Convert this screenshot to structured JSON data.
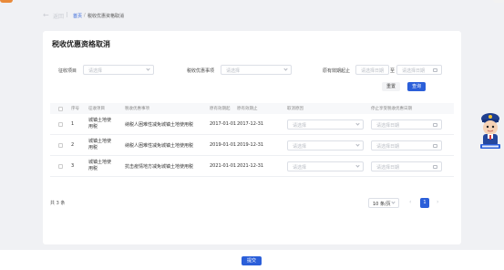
{
  "nav": {
    "back": "返回",
    "home": "首页",
    "sep": "/",
    "current": "税收优惠资格取消",
    "back_icon": "arrow-left-icon"
  },
  "page": {
    "title": "税收优惠资格取消"
  },
  "filters": {
    "levy_item_label": "征收项目",
    "levy_item_placeholder": "请选择",
    "pref_item_label": "税收优惠事项",
    "pref_item_placeholder": "请选择",
    "valid_range_label": "原有效期起止",
    "start_placeholder": "请选择日期",
    "range_sep": "至",
    "end_placeholder": "请选择日期"
  },
  "buttons": {
    "reset": "重置",
    "query": "查询",
    "submit": "提交"
  },
  "table": {
    "headers": [
      "序号",
      "征收项目",
      "税收优惠事项",
      "原有效期起",
      "原有效期止",
      "取消原因",
      "停止享受税收优惠日期"
    ],
    "rows": [
      {
        "index": "1",
        "levy_item": "城镇土地使用税",
        "pref_item": "纳税人困难性减免城镇土地使用税",
        "start": "2017-01-01",
        "end": "2017-12-31",
        "reason": "请选择",
        "stop_date": "请选择日期"
      },
      {
        "index": "2",
        "levy_item": "城镇土地使用税",
        "pref_item": "纳税人困难性减免城镇土地使用税",
        "start": "2019-01-01",
        "end": "2019-12-31",
        "reason": "请选择",
        "stop_date": "请选择日期"
      },
      {
        "index": "3",
        "levy_item": "城镇土地使用税",
        "pref_item": "抗击疫情地方减免城镇土地使用税",
        "start": "2021-01-01",
        "end": "2021-12-31",
        "reason": "请选择",
        "stop_date": "请选择日期"
      }
    ]
  },
  "pagination": {
    "total": "共 3 条",
    "page_size": "10 条/页",
    "current_page": "1",
    "prev": "‹",
    "next": "›"
  },
  "colors": {
    "primary": "#2b5fd9",
    "background": "#f0f1f4",
    "card": "#ffffff"
  },
  "assistant": {
    "icon": "tax-officer-mascot-icon"
  }
}
